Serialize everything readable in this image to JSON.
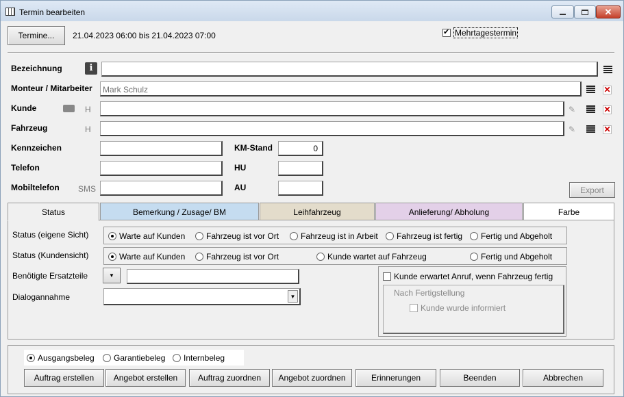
{
  "window": {
    "title": "Termin bearbeiten"
  },
  "header": {
    "termine_button": "Termine...",
    "date_range": "21.04.2023 06:00 bis 21.04.2023 07:00",
    "mehrtage_label": "Mehrtagestermin",
    "mehrtage_checked": true
  },
  "form": {
    "bezeichnung_label": "Bezeichnung",
    "bezeichnung_value": "",
    "monteur_label": "Monteur / Mitarbeiter",
    "monteur_value": "Mark Schulz",
    "kunde_label": "Kunde",
    "kunde_h": "H",
    "fahrzeug_label": "Fahrzeug",
    "fahrzeug_h": "H",
    "kennzeichen_label": "Kennzeichen",
    "telefon_label": "Telefon",
    "mobiltelefon_label": "Mobiltelefon",
    "sms_label": "SMS",
    "km_label": "KM-Stand",
    "km_value": "0",
    "hu_label": "HU",
    "au_label": "AU",
    "export_button": "Export"
  },
  "tabs": [
    {
      "label": "Status",
      "color": "#f0f0f0"
    },
    {
      "label": "Bemerkung / Zusage/ BM",
      "color": "#c5dcf0"
    },
    {
      "label": "Leihfahrzeug",
      "color": "#e3dccb"
    },
    {
      "label": "Anlieferung/ Abholung",
      "color": "#e3d0e8"
    },
    {
      "label": "Farbe",
      "color": "#ffffff"
    }
  ],
  "status": {
    "eigene_label": "Status (eigene Sicht)",
    "eigene_options": [
      "Warte auf Kunden",
      "Fahrzeug ist vor Ort",
      "Fahrzeug ist in Arbeit",
      "Fahrzeug ist fertig",
      "Fertig und Abgeholt"
    ],
    "kunden_label": "Status (Kundensicht)",
    "kunden_options": [
      "Warte auf Kunden",
      "Fahrzeug ist vor Ort",
      "Kunde wartet auf Fahrzeug",
      "Fertig und Abgeholt"
    ],
    "ersatzteile_label": "Benötigte Ersatzteile",
    "dialog_label": "Dialogannahme",
    "anruf_label": "Kunde erwartet Anruf, wenn Fahrzeug fertig",
    "nach_label": "Nach Fertigstellung",
    "informiert_label": "Kunde wurde informiert"
  },
  "beleg": {
    "options": [
      "Ausgangsbeleg",
      "Garantiebeleg",
      "Internbeleg"
    ]
  },
  "buttons": {
    "auftrag_erstellen": "Auftrag erstellen",
    "angebot_erstellen": "Angebot erstellen",
    "auftrag_zuordnen": "Auftrag zuordnen",
    "angebot_zuordnen": "Angebot zuordnen",
    "erinnerungen": "Erinnerungen",
    "beenden": "Beenden",
    "abbrechen": "Abbrechen"
  },
  "colors": {
    "close_button": "#c4402a",
    "delete_icon": "#cc0000"
  }
}
